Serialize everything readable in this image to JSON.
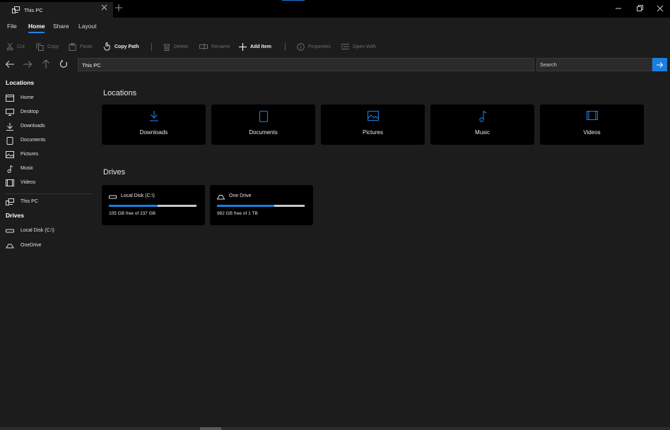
{
  "colors": {
    "accent": "#1a7fe0",
    "background": "#1c1c1c",
    "card": "#000000",
    "disabled": "#6b6b6b"
  },
  "titlebar": {
    "tab_title": "This PC",
    "tab_icon": "pc-icon"
  },
  "menu": {
    "file": "File",
    "home": "Home",
    "share": "Share",
    "layout": "Layout"
  },
  "toolbar": {
    "cut": "Cut",
    "copy": "Copy",
    "paste": "Paste",
    "copy_path": "Copy Path",
    "delete": "Delete",
    "rename": "Rename",
    "add_item": "Add Item",
    "properties": "Properties",
    "open_with": "Open With"
  },
  "address": {
    "path": "This PC"
  },
  "search": {
    "placeholder": "Search"
  },
  "sidebar": {
    "locations_header": "Locations",
    "items": [
      {
        "label": "Home",
        "icon": "home-icon"
      },
      {
        "label": "Desktop",
        "icon": "desktop-icon"
      },
      {
        "label": "Downloads",
        "icon": "download-icon"
      },
      {
        "label": "Documents",
        "icon": "document-icon"
      },
      {
        "label": "Pictures",
        "icon": "picture-icon"
      },
      {
        "label": "Music",
        "icon": "music-icon"
      },
      {
        "label": "Videos",
        "icon": "video-icon"
      }
    ],
    "this_pc": "This PC",
    "drives_header": "Drives",
    "drives": [
      {
        "label": "Local Disk (C:\\)",
        "icon": "disk-icon"
      },
      {
        "label": "OneDrive",
        "icon": "cloud-icon"
      }
    ]
  },
  "main": {
    "locations_title": "Locations",
    "locations": [
      {
        "label": "Downloads",
        "icon": "download-icon"
      },
      {
        "label": "Documents",
        "icon": "document-icon"
      },
      {
        "label": "Pictures",
        "icon": "picture-icon"
      },
      {
        "label": "Music",
        "icon": "music-icon"
      },
      {
        "label": "Videos",
        "icon": "video-icon"
      }
    ],
    "drives_title": "Drives",
    "drives": [
      {
        "name": "Local Disk (C:\\)",
        "free": "105 GB free of 237 GB",
        "used_fraction": 0.557
      },
      {
        "name": "One Drive",
        "free": "982 GB free of 1 TB",
        "used_fraction": 0.65
      }
    ]
  }
}
